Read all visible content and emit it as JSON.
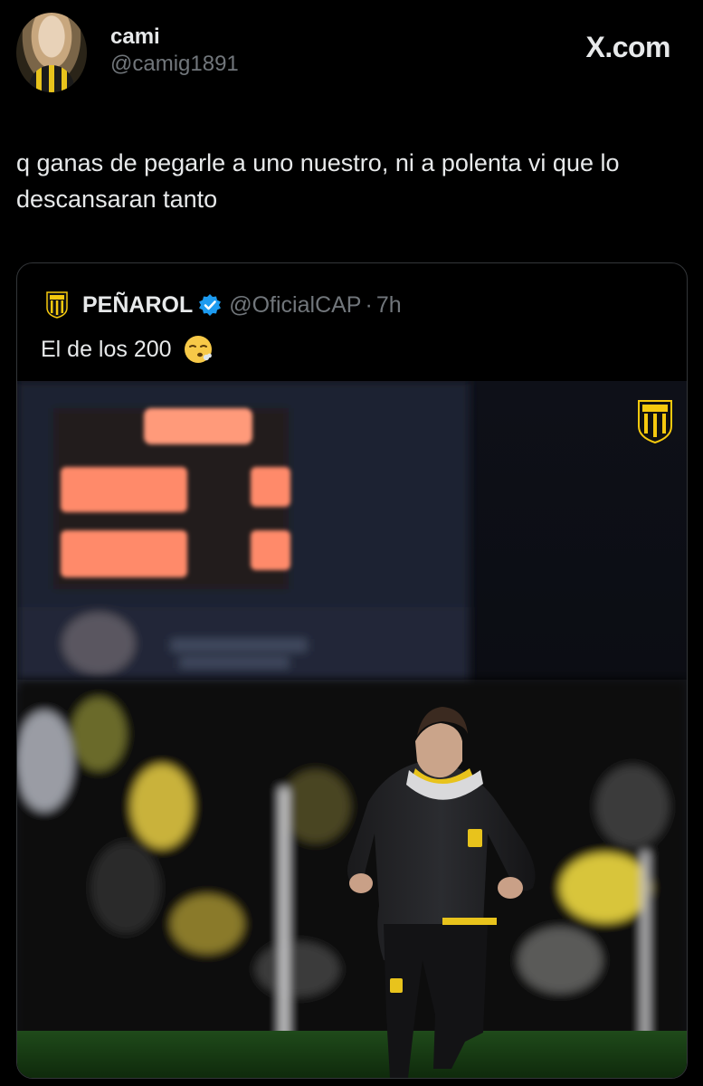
{
  "tweet": {
    "author_name": "cami",
    "author_handle": "@camig1891",
    "brand": "X.com",
    "text": "q ganas de pegarle a uno nuestro, ni a polenta vi que lo descansaran tanto"
  },
  "quote": {
    "author_name": "PEÑAROL",
    "author_handle": "@OficialCAP",
    "separator": "·",
    "time": "7h",
    "text": "El de los 200",
    "emoji": "face-exhaling-emoji"
  },
  "photo": {
    "scoreboard_digits": "7:77",
    "description_icon": "penarol-shield-watermark"
  },
  "colors": {
    "background": "#000000",
    "text": "#e7e9ea",
    "secondary_text": "#71767b",
    "border": "#333639",
    "verified_blue": "#1d9bf0",
    "club_yellow": "#f6c90e"
  }
}
